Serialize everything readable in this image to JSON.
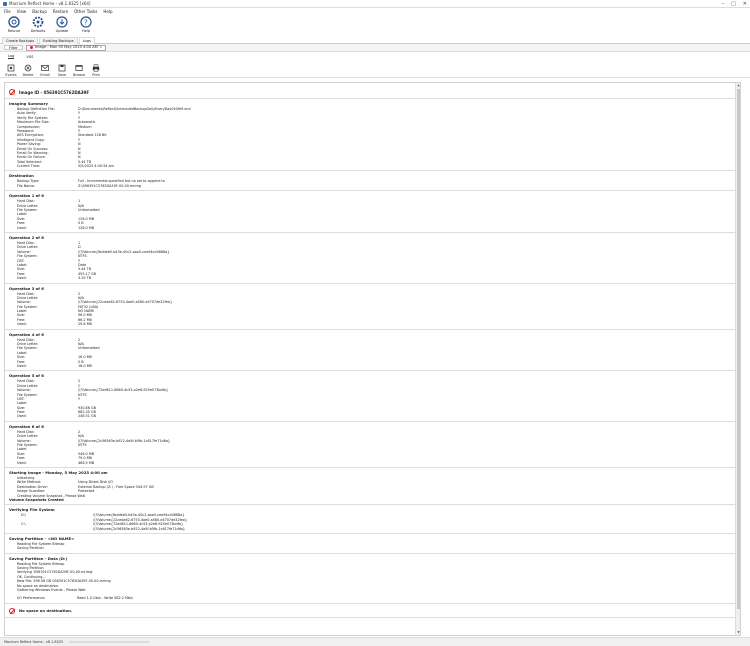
{
  "window": {
    "title": "Macrium Reflect Home - v8.1.8325  [x64]",
    "controls": [
      "–",
      "□",
      "✕"
    ]
  },
  "menu": [
    "File",
    "View",
    "Backup",
    "Restore",
    "Other Tasks",
    "Help"
  ],
  "ribbon": [
    {
      "label": "Rescue",
      "icon": "rescue-icon"
    },
    {
      "label": "Defaults",
      "icon": "defaults-icon"
    },
    {
      "label": "Update",
      "icon": "update-icon"
    },
    {
      "label": "Help",
      "icon": "help-icon"
    }
  ],
  "main_tabs": [
    "Create Backups",
    "Existing Backups",
    "Logs"
  ],
  "log_tabs": {
    "filter": "Filter",
    "current": "Image - Mon 05 May 2025 4:00 AM",
    "close": "x"
  },
  "sub_tabs": [
    "Log",
    "VSS"
  ],
  "toolbar": [
    {
      "label": "Events",
      "icon": "events-icon"
    },
    {
      "label": "Delete",
      "icon": "delete-icon"
    },
    {
      "label": "Email",
      "icon": "email-icon"
    },
    {
      "label": "Save",
      "icon": "save-icon"
    },
    {
      "label": "Browse",
      "icon": "browse-icon"
    },
    {
      "label": "Print",
      "icon": "print-icon"
    }
  ],
  "log": {
    "image_id": "Image ID - 056391C5762DA39F",
    "summary": {
      "title": "Imaging Summary",
      "rows": [
        [
          "Backup Definition File:",
          "D:\\Documents\\Reflect\\ScheduledBackupDailyEveryDay040HM.xml"
        ],
        [
          "Auto Verify:",
          "Y"
        ],
        [
          "Verify File System:",
          "Y"
        ],
        [
          "Maximum File Size:",
          "Automatic"
        ],
        [
          "Compression:",
          "Medium"
        ],
        [
          "Password:",
          "Y"
        ],
        [
          "AES Encryption:",
          "Standard 128 Bit"
        ],
        [
          "Intelligent Copy:",
          "Y"
        ],
        [
          "Power Saving:",
          "N"
        ],
        [
          "Email On Success:",
          "N"
        ],
        [
          "Email On Warning:",
          "N"
        ],
        [
          "Email On Failure:",
          "N"
        ],
        [
          "Total Selected:",
          "5.44 TB"
        ],
        [
          "Current Time:",
          "5/5/2025 4:00:34 am"
        ]
      ]
    },
    "destination": {
      "title": "Destination",
      "rows": [
        [
          "Backup Type:",
          "Full - Incremental specified but no set to append to"
        ],
        [
          "File Name:",
          "Z:\\056391C5762DA39F-00-00.mrimg"
        ]
      ]
    },
    "operations": [
      {
        "title": "Operation 1 of 6",
        "rows": [
          [
            "Hard Disk:",
            "1"
          ],
          [
            "Drive Letter:",
            "N/A"
          ],
          [
            "File System:",
            "Unformatted"
          ],
          [
            "Label:",
            ""
          ],
          [
            "Size:",
            "128.0 MB"
          ],
          [
            "Free:",
            "0 B"
          ],
          [
            "Used:",
            "128.0 MB"
          ]
        ]
      },
      {
        "title": "Operation 2 of 6",
        "rows": [
          [
            "Hard Disk:",
            "1"
          ],
          [
            "Drive Letter:",
            "D"
          ],
          [
            "Volume:",
            "\\\\?\\Volume{fbddeb5-b45e-40c2-aaa5-cea94cd4668a}"
          ],
          [
            "File System:",
            "NTFS"
          ],
          [
            "CBT:",
            "Y"
          ],
          [
            "Label:",
            "Data"
          ],
          [
            "Size:",
            "5.44 TB"
          ],
          [
            "Free:",
            "455.17 GB"
          ],
          [
            "Used:",
            "3.29 TB"
          ]
        ]
      },
      {
        "title": "Operation 3 of 6",
        "rows": [
          [
            "Hard Disk:",
            "2"
          ],
          [
            "Drive Letter:",
            "N/A"
          ],
          [
            "Volume:",
            "\\\\?\\Volume{22ceda62-6753-4ae0-a580-e4707de32fea}"
          ],
          [
            "File System:",
            "FAT32 (LBA)"
          ],
          [
            "Label:",
            "NO NAME"
          ],
          [
            "Size:",
            "96.0 MB"
          ],
          [
            "Free:",
            "66.2 MB"
          ],
          [
            "Used:",
            "29.8 MB"
          ]
        ]
      },
      {
        "title": "Operation 4 of 6",
        "rows": [
          [
            "Hard Disk:",
            "2"
          ],
          [
            "Drive Letter:",
            "N/A"
          ],
          [
            "File System:",
            "Unformatted"
          ],
          [
            "Label:",
            ""
          ],
          [
            "Size:",
            "16.0 MB"
          ],
          [
            "Free:",
            "0 B"
          ],
          [
            "Used:",
            "16.0 MB"
          ]
        ]
      },
      {
        "title": "Operation 5 of 6",
        "rows": [
          [
            "Hard Disk:",
            "2"
          ],
          [
            "Drive Letter:",
            "C"
          ],
          [
            "Volume:",
            "\\\\?\\Volume{72ed611-8660-4c53-a2e6-925e073bdfa}"
          ],
          [
            "File System:",
            "NTFS"
          ],
          [
            "CBT:",
            "Y"
          ],
          [
            "Label:",
            ""
          ],
          [
            "Size:",
            "930.86 GB"
          ],
          [
            "Free:",
            "682.35 GB"
          ],
          [
            "Used:",
            "248.51 GB"
          ]
        ]
      },
      {
        "title": "Operation 6 of 6",
        "rows": [
          [
            "Hard Disk:",
            "2"
          ],
          [
            "Drive Letter:",
            "N/A"
          ],
          [
            "Volume:",
            "\\\\?\\Volume{2c56563e-b922-4a5f-b5fb-1c617fe71d6a}"
          ],
          [
            "File System:",
            "NTFS"
          ],
          [
            "Label:",
            ""
          ],
          [
            "Size:",
            "546.0 MB"
          ],
          [
            "Free:",
            "79.0 MB"
          ],
          [
            "Used:",
            "466.5 MB"
          ]
        ]
      }
    ],
    "starting": {
      "title": "Starting Image - Monday, 5 May 2025 4:00 am",
      "rows": [
        [
          "Initializing",
          ""
        ],
        [
          "Write Method:",
          "Using Direct Disk I/O"
        ],
        [
          "Destination Drive:",
          "External Backup (Z:) - Free Space 544.97 GB"
        ],
        [
          "Image Guardian:",
          "Protected"
        ],
        [
          "Creating Volume Snapshot - Please Wait",
          ""
        ]
      ],
      "vss": "Volume Snapshots Created"
    },
    "verifying": {
      "title": "Verifying File System",
      "rows": [
        [
          "D:\\",
          "\\\\?\\Volume{fbddeb5-b45e-40c2-aaa5-cea94cd4668a}"
        ],
        [
          "",
          "\\\\?\\Volume{22ceda62-6753-4ae0-a580-e4707de32fea}"
        ],
        [
          "C:\\",
          "\\\\?\\Volume{72ed611-8660-4c53-a2e6-925e073bdfa}"
        ],
        [
          "",
          "\\\\?\\Volume{2c56563e-b922-4a5f-b5fb-1c617fe71d6a}"
        ]
      ]
    },
    "saving1": {
      "title": "Saving Partition - <NO NAME>",
      "lines": [
        "Reading File System Bitmap",
        "Saving Partition"
      ]
    },
    "saving2": {
      "title": "Saving Partition - Data (D:)",
      "lines": [
        "Reading File System Bitmap",
        "Saving Partition",
        "Verifying '056391C5762DA39F-00-00.mrimg'",
        "OK, Continuing...",
        "New File: 596.56 GB          056391C5762DA39F-00-00.mrimg",
        "No space on destination.",
        "Gathering Windows Events - Please Wait"
      ]
    },
    "performance": {
      "label": "I/O Performance:",
      "value": "Read 1.0 Gb/s - Write 582.2 Mb/s"
    },
    "final": "No space on destination."
  },
  "status": {
    "text": "Macrium Reflect Home - v8.1.8325"
  }
}
